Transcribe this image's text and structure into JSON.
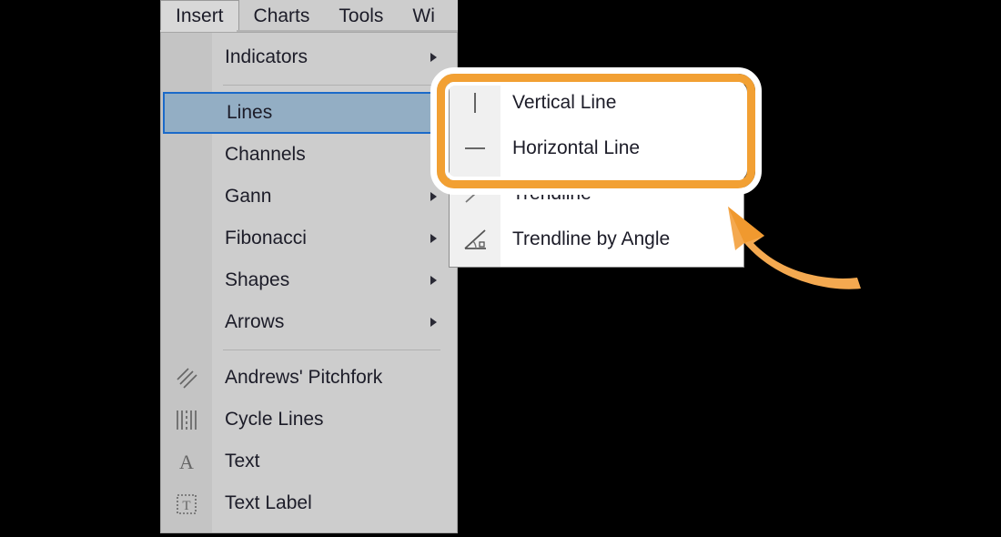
{
  "app": {
    "background_color": "#000000",
    "menu_bg_color": "#cdcdcd",
    "accent_color": "#f2a033",
    "selection_border_color": "#1b6ac9",
    "selection_fill_color": "#93aec4"
  },
  "menubar": {
    "tabs": [
      {
        "label": "Insert",
        "active": true
      },
      {
        "label": "Charts",
        "active": false
      },
      {
        "label": "Tools",
        "active": false
      },
      {
        "label": "Wi",
        "active": false
      }
    ]
  },
  "dropdown": {
    "name": "insert-menu",
    "items": [
      {
        "label": "Indicators",
        "icon": "none",
        "submenu": true,
        "selected": false
      },
      {
        "separator": true
      },
      {
        "label": "Lines",
        "icon": "none",
        "submenu": true,
        "selected": true
      },
      {
        "label": "Channels",
        "icon": "none",
        "submenu": true,
        "selected": false
      },
      {
        "label": "Gann",
        "icon": "none",
        "submenu": true,
        "selected": false
      },
      {
        "label": "Fibonacci",
        "icon": "none",
        "submenu": true,
        "selected": false
      },
      {
        "label": "Shapes",
        "icon": "none",
        "submenu": true,
        "selected": false
      },
      {
        "label": "Arrows",
        "icon": "none",
        "submenu": true,
        "selected": false
      },
      {
        "separator": true
      },
      {
        "label": "Andrews' Pitchfork",
        "icon": "pitchfork-icon",
        "submenu": false,
        "selected": false
      },
      {
        "label": "Cycle Lines",
        "icon": "cycle-lines-icon",
        "submenu": false,
        "selected": false
      },
      {
        "label": "Text",
        "icon": "text-a-icon",
        "submenu": false,
        "selected": false
      },
      {
        "label": "Text Label",
        "icon": "text-label-icon",
        "submenu": false,
        "selected": false
      }
    ]
  },
  "submenu": {
    "name": "lines-submenu",
    "items": [
      {
        "label": "Vertical Line",
        "icon": "vertical-line-icon"
      },
      {
        "label": "Horizontal Line",
        "icon": "horizontal-line-icon"
      },
      {
        "label": "Trendline",
        "icon": "trendline-icon"
      },
      {
        "label": "Trendline by Angle",
        "icon": "trendline-by-angle-icon"
      }
    ]
  },
  "annotation": {
    "callout_label": "highlight-box-around-vertical-and-horizontal-line",
    "arrow_label": "curved-pointer-arrow"
  }
}
